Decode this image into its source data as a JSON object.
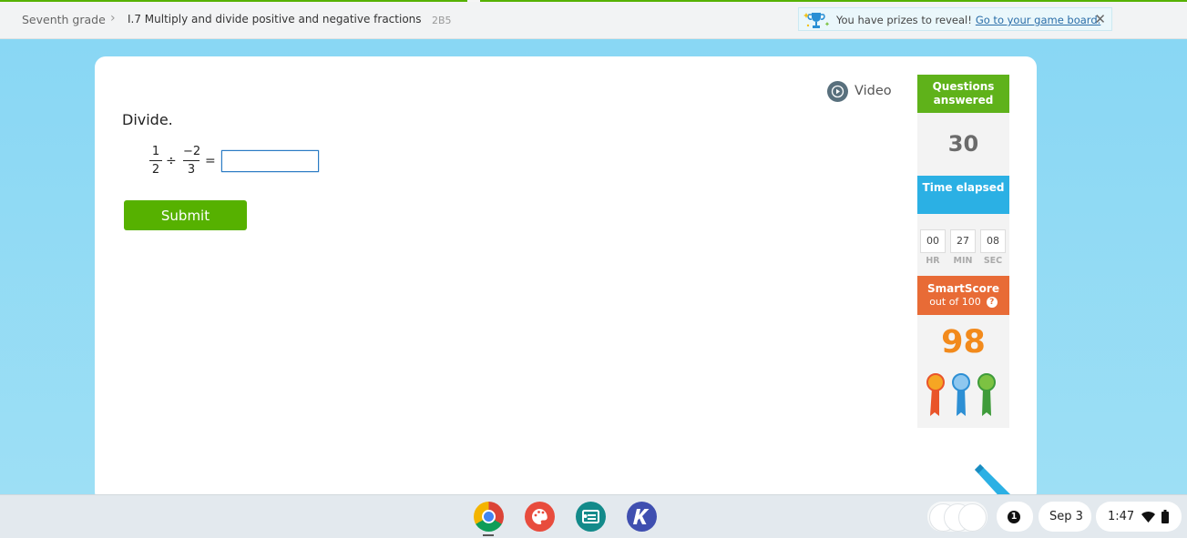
{
  "breadcrumb": {
    "grade": "Seventh grade",
    "skill": "I.7 Multiply and divide positive and negative fractions",
    "code": "2B5"
  },
  "prize_banner": {
    "text": "You have prizes to reveal!",
    "link": "Go to your game board."
  },
  "question": {
    "video_label": "Video",
    "prompt": "Divide.",
    "fraction1": {
      "numerator": "1",
      "denominator": "2"
    },
    "operator": "÷",
    "fraction2": {
      "numerator": "−2",
      "denominator": "3"
    },
    "equals": "=",
    "answer_value": "",
    "submit_label": "Submit"
  },
  "sidebar": {
    "questions_answered_label": "Questions answered",
    "questions_answered_value": "30",
    "time_elapsed_label": "Time elapsed",
    "time": {
      "hr": "00",
      "min": "27",
      "sec": "08"
    },
    "time_units": {
      "hr": "HR",
      "min": "MIN",
      "sec": "SEC"
    },
    "smartscore_label": "SmartScore",
    "smartscore_sub": "out of 100",
    "help": "?",
    "smartscore_value": "98"
  },
  "shelf": {
    "notification_count": "1",
    "date": "Sep 3",
    "time": "1:47"
  },
  "colors": {
    "green": "#56b100",
    "blue": "#2bb0e4",
    "orange": "#e86b36",
    "score": "#f28a1c"
  }
}
